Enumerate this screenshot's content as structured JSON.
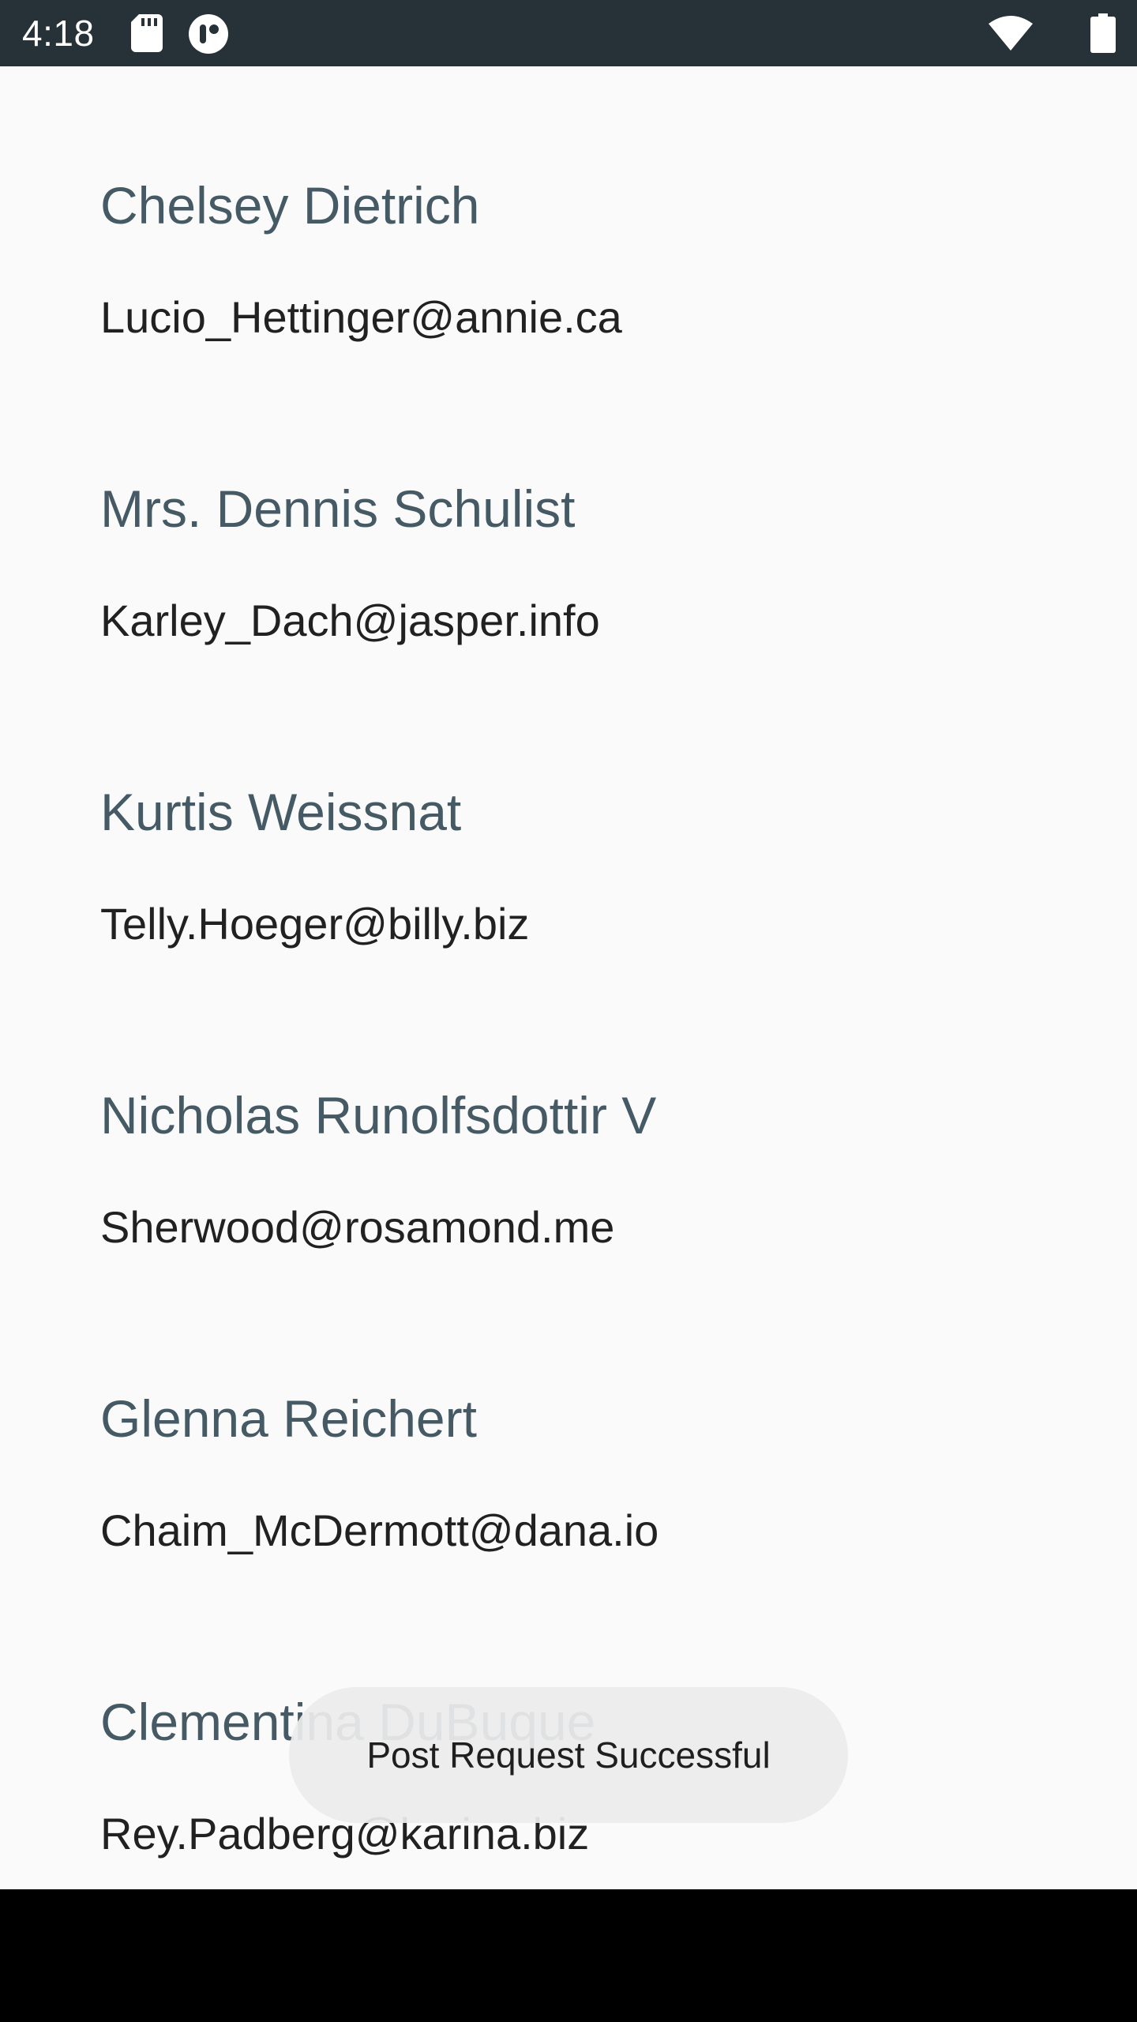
{
  "status_bar": {
    "time": "4:18",
    "icons": [
      "sd-card-icon",
      "app-notification-icon",
      "wifi-icon",
      "battery-icon"
    ],
    "background": "#263238"
  },
  "users": [
    {
      "name": "Chelsey Dietrich",
      "email": "Lucio_Hettinger@annie.ca"
    },
    {
      "name": "Mrs. Dennis Schulist",
      "email": "Karley_Dach@jasper.info"
    },
    {
      "name": "Kurtis Weissnat",
      "email": "Telly.Hoeger@billy.biz"
    },
    {
      "name": "Nicholas Runolfsdottir V",
      "email": "Sherwood@rosamond.me"
    },
    {
      "name": "Glenna Reichert",
      "email": "Chaim_McDermott@dana.io"
    },
    {
      "name": "Clementina DuBuque",
      "email": "Rey.Padberg@karina.biz"
    }
  ],
  "toast": {
    "message": "Post Request Successful"
  },
  "colors": {
    "name_text": "#455a64",
    "email_text": "#212121",
    "background": "#fafafa"
  }
}
